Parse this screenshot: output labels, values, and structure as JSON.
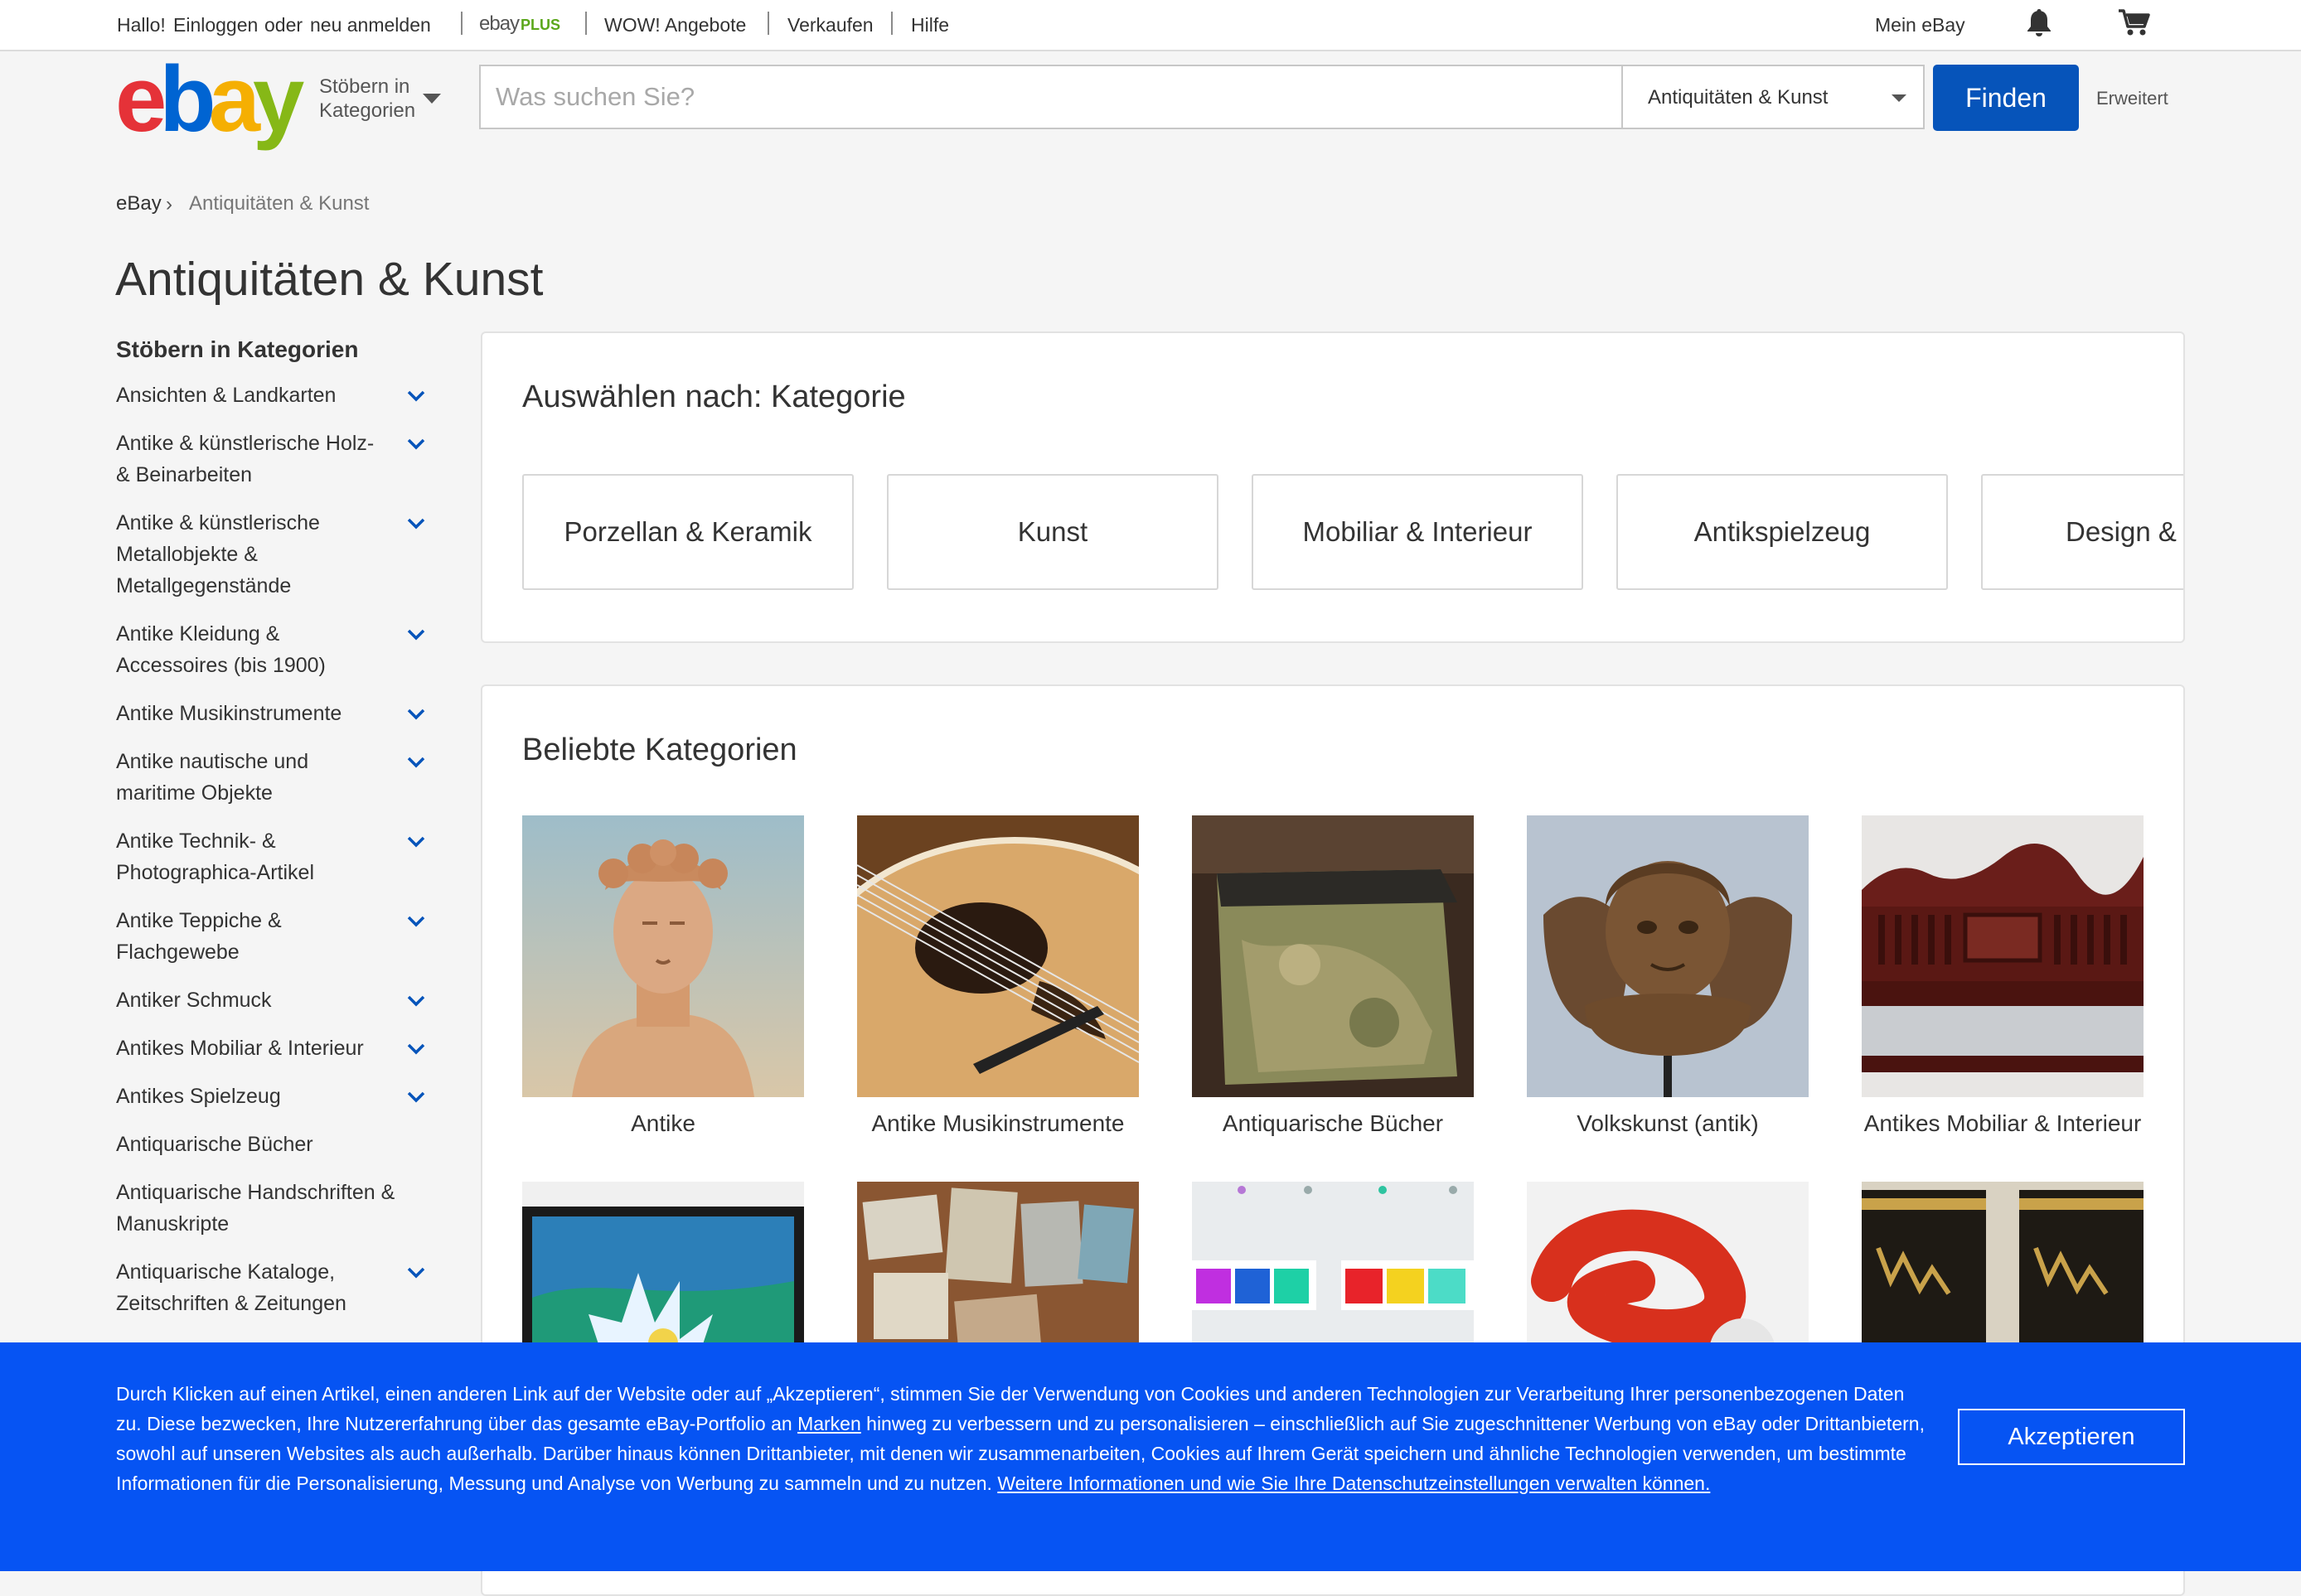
{
  "topbar": {
    "greeting": "Hallo!",
    "signin": "Einloggen",
    "or": "oder",
    "register": "neu anmelden",
    "plus_logo_ebay": "ebay",
    "plus_logo_plus": "PLUS",
    "deals": "WOW! Angebote",
    "sell": "Verkaufen",
    "help": "Hilfe",
    "my_ebay": "Mein eBay",
    "icons": [
      "bell-icon",
      "cart-icon"
    ]
  },
  "header": {
    "logo": [
      "e",
      "b",
      "a",
      "y"
    ],
    "browse_line1": "Stöbern in",
    "browse_line2": "Kategorien",
    "search_placeholder": "Was suchen Sie?",
    "category_select": "Antiquitäten & Kunst",
    "find_button": "Finden",
    "advanced": "Erweitert"
  },
  "breadcrumb": {
    "root": "eBay",
    "separator": "›",
    "current": "Antiquitäten & Kunst"
  },
  "page_title": "Antiquitäten & Kunst",
  "sidebar": {
    "heading": "Stöbern in Kategorien",
    "items": [
      {
        "label": "Ansichten & Landkarten",
        "expandable": true
      },
      {
        "label": "Antike & künstlerische Holz- & Beinarbeiten",
        "expandable": true
      },
      {
        "label": "Antike & künstlerische Metallobjekte & Metallgegenstände",
        "expandable": true
      },
      {
        "label": "Antike Kleidung & Accessoires (bis 1900)",
        "expandable": true
      },
      {
        "label": "Antike Musikinstrumente",
        "expandable": true
      },
      {
        "label": "Antike nautische und maritime Objekte",
        "expandable": true
      },
      {
        "label": "Antike Technik- & Photographica-Artikel",
        "expandable": true
      },
      {
        "label": "Antike Teppiche & Flachgewebe",
        "expandable": true
      },
      {
        "label": "Antiker Schmuck",
        "expandable": true
      },
      {
        "label": "Antikes Mobiliar & Interieur",
        "expandable": true
      },
      {
        "label": "Antikes Spielzeug",
        "expandable": true
      },
      {
        "label": "Antiquarische Bücher",
        "expandable": false
      },
      {
        "label": "Antiquarische Handschriften & Manuskripte",
        "expandable": false
      },
      {
        "label": "Antiquarische Kataloge, Zeitschriften & Zeitungen",
        "expandable": true
      }
    ]
  },
  "select_by_category": {
    "title": "Auswählen nach: Kategorie",
    "cards": [
      "Porzellan & Keramik",
      "Kunst",
      "Mobiliar & Interieur",
      "Antikspielzeug",
      "Design &"
    ]
  },
  "popular": {
    "title": "Beliebte Kategorien",
    "tiles": [
      {
        "label": "Antike"
      },
      {
        "label": "Antike Musikinstrumente"
      },
      {
        "label": "Antiquarische Bücher"
      },
      {
        "label": "Volkskunst (antik)"
      },
      {
        "label": "Antikes Mobiliar & Interieur"
      }
    ]
  },
  "cookie": {
    "text_before": "Durch Klicken auf einen Artikel, einen anderen Link auf der Website oder auf „Akzeptieren“, stimmen Sie der Verwendung von Cookies und anderen Technologien zur Verarbeitung Ihrer personenbezogenen Daten zu. Diese bezwecken, Ihre Nutzererfahrung über das gesamte eBay-Portfolio an ",
    "brands_link": "Marken",
    "text_middle": " hinweg zu verbessern und zu personalisieren – einschließlich auf Sie zugeschnittener Werbung von eBay oder Drittanbietern, sowohl auf unseren Websites als auch außerhalb. Darüber hinaus können Drittanbieter, mit denen wir zusammenarbeiten, Cookies auf Ihrem Gerät speichern und ähnliche Technologien verwenden, um bestimmte Informationen für die Personalisierung, Messung und Analyse von Werbung zu sammeln und zu nutzen. ",
    "more_link": "Weitere Informationen und wie Sie Ihre Datenschutzeinstellungen verwalten können.",
    "accept": "Akzeptieren"
  }
}
